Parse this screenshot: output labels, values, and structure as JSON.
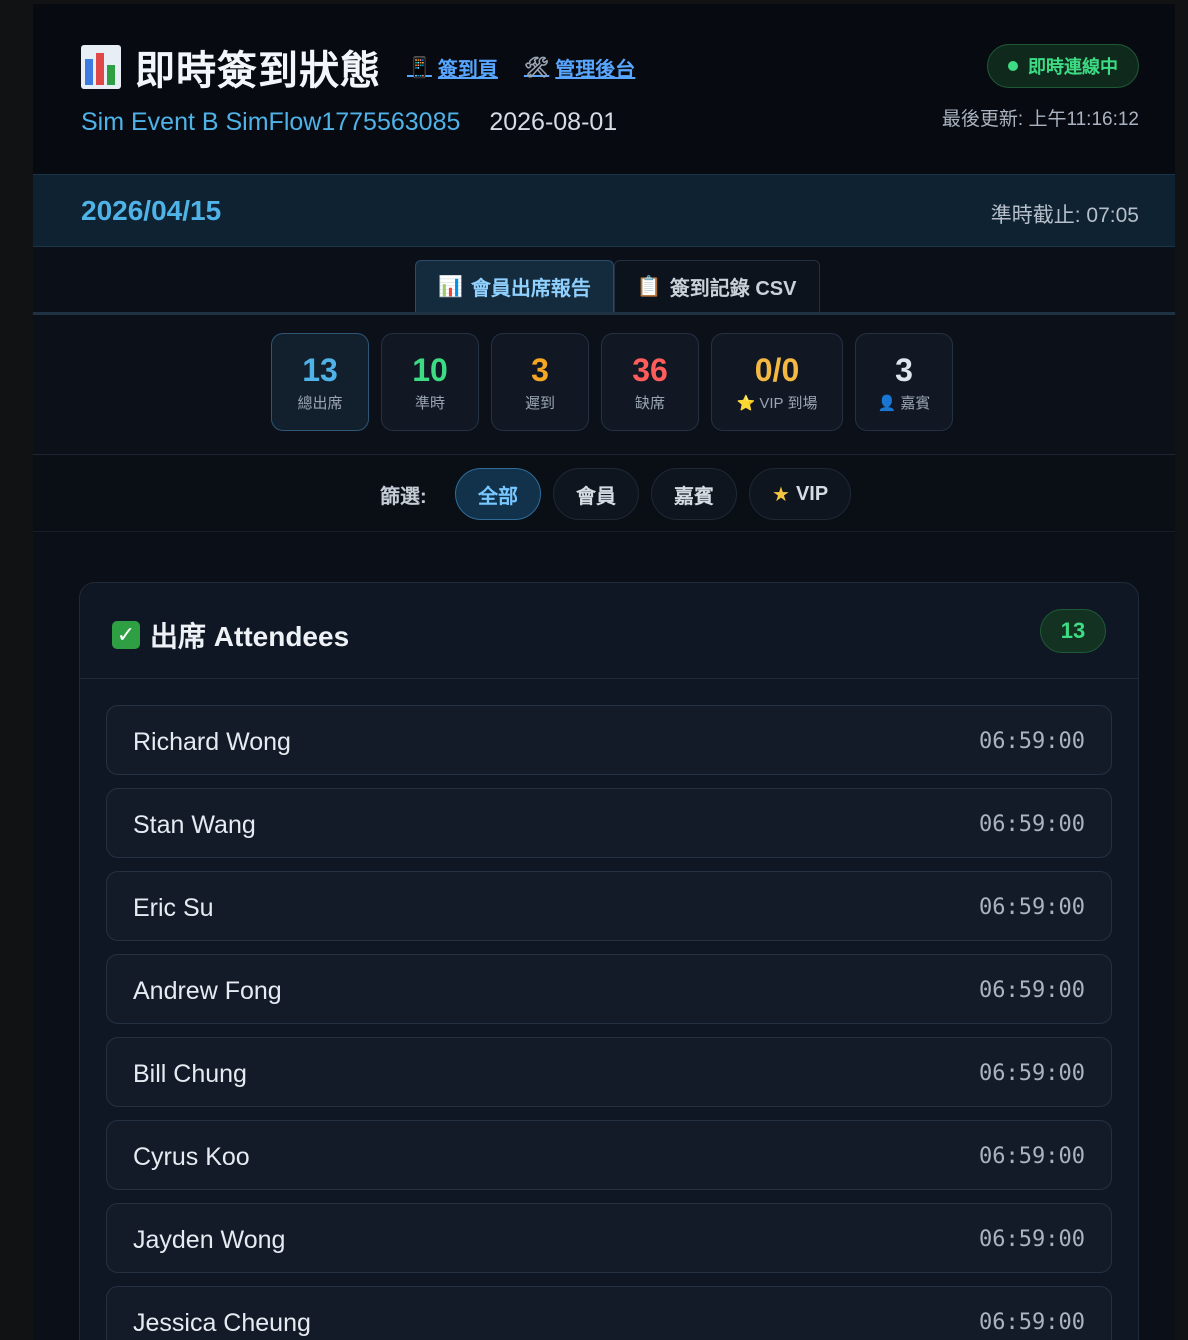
{
  "header": {
    "title": "即時簽到狀態",
    "links": [
      {
        "icon": "phone-icon",
        "glyph": "📱",
        "label": "簽到頁"
      },
      {
        "icon": "tools-icon",
        "glyph": "🛠",
        "label": "管理後台"
      }
    ],
    "event_name": "Sim Event B SimFlow1775563085",
    "event_date": "2026-08-01",
    "live_status": "即時連線中",
    "last_updated": "最後更新: 上午11:16:12"
  },
  "datebar": {
    "date": "2026/04/15",
    "cutoff": "準時截止: 07:05"
  },
  "tabs": [
    {
      "icon": "chart-icon",
      "glyph": "📊",
      "label": "會員出席報告",
      "active": true
    },
    {
      "icon": "clipboard-icon",
      "glyph": "📋",
      "label": "簽到記錄 CSV",
      "active": false
    }
  ],
  "stats": [
    {
      "value": "13",
      "label": "總出席",
      "color": "#4fb3e8",
      "width": 98
    },
    {
      "value": "10",
      "label": "準時",
      "color": "#3ddc84",
      "width": 98
    },
    {
      "value": "3",
      "label": "遲到",
      "color": "#f5a623",
      "width": 98
    },
    {
      "value": "36",
      "label": "缺席",
      "color": "#ff5c5c",
      "width": 98
    },
    {
      "value": "0/0",
      "label": "⭐ VIP 到場",
      "color": "#f5b942",
      "width": 132
    },
    {
      "value": "3",
      "label": "👤 嘉賓",
      "color": "#dfe5ec",
      "width": 98
    }
  ],
  "filters": {
    "label": "篩選:",
    "options": [
      {
        "label": "全部",
        "active": true,
        "star": false
      },
      {
        "label": "會員",
        "active": false,
        "star": false
      },
      {
        "label": "嘉賓",
        "active": false,
        "star": false
      },
      {
        "label": "VIP",
        "active": false,
        "star": true
      }
    ]
  },
  "panel": {
    "title": "出席 Attendees",
    "count": "13",
    "attendees": [
      {
        "name": "Richard Wong",
        "time": "06:59:00"
      },
      {
        "name": "Stan Wang",
        "time": "06:59:00"
      },
      {
        "name": "Eric Su",
        "time": "06:59:00"
      },
      {
        "name": "Andrew Fong",
        "time": "06:59:00"
      },
      {
        "name": "Bill Chung",
        "time": "06:59:00"
      },
      {
        "name": "Cyrus Koo",
        "time": "06:59:00"
      },
      {
        "name": "Jayden Wong",
        "time": "06:59:00"
      },
      {
        "name": "Jessica Cheung",
        "time": "06:59:00"
      }
    ]
  }
}
